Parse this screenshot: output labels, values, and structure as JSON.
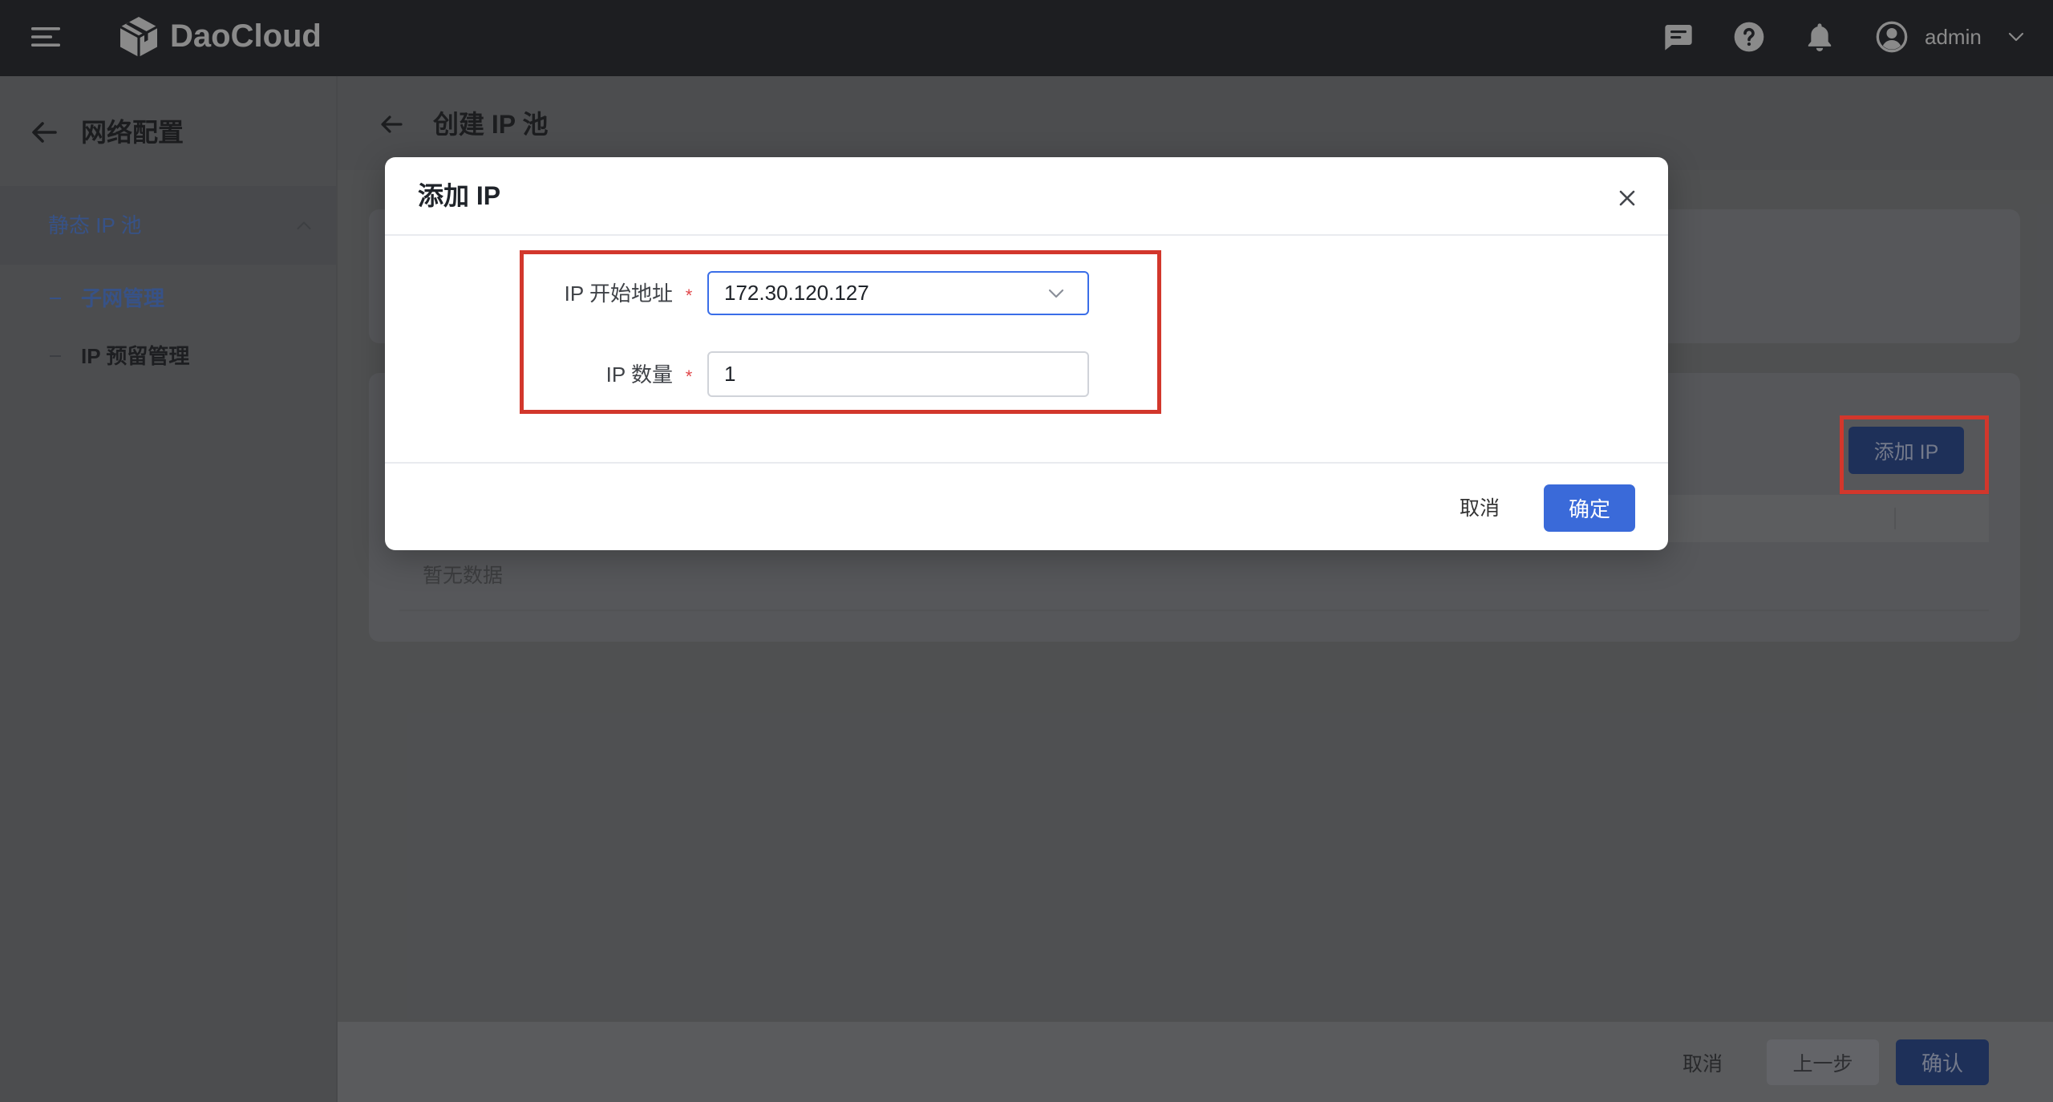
{
  "topbar": {
    "brand": "DaoCloud",
    "user": "admin",
    "icons": [
      "menu-icon",
      "daocloud-logo-icon",
      "message-icon",
      "help-icon",
      "bell-icon",
      "avatar-icon",
      "chevron-down-icon"
    ]
  },
  "sidebar": {
    "title": "网络配置",
    "group": "静态 IP 池",
    "items": [
      {
        "label": "子网管理",
        "active": true
      },
      {
        "label": "IP 预留管理",
        "active": false
      }
    ]
  },
  "page": {
    "title": "创建 IP 池",
    "add_ip_label": "添加 IP",
    "table_empty": "暂无数据",
    "footer": {
      "cancel": "取消",
      "previous": "上一步",
      "confirm": "确认"
    }
  },
  "modal": {
    "title": "添加 IP",
    "fields": [
      {
        "label": "IP 开始地址",
        "required": "*",
        "value": "172.30.120.127"
      },
      {
        "label": "IP 数量",
        "required": "*",
        "value": "1"
      }
    ],
    "cancel_label": "取消",
    "ok_label": "确定"
  },
  "colors": {
    "primary": "#3a6ad9",
    "required_mark": "#e0474a",
    "annotation": "#d2372c",
    "topbar": "#36383d"
  }
}
